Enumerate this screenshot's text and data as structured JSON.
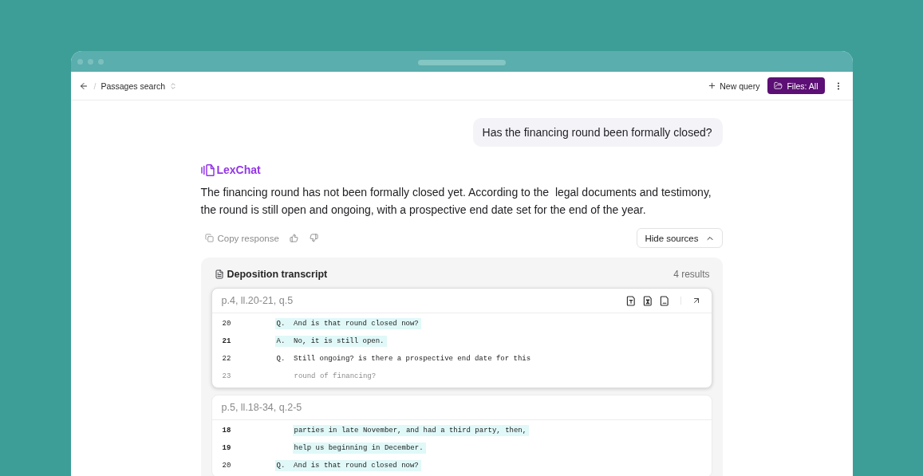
{
  "toolbar": {
    "separator": "/",
    "breadcrumb": "Passages search",
    "new_query": "New query",
    "files_button": "Files: All"
  },
  "conversation": {
    "question": "Has the financing round been formally closed?",
    "assistant_name": "LexChat",
    "answer": "The financing round has not been formally closed yet. According to the  legal documents and testimony, the round is still open and ongoing, with a prospective end date set for the end of the year.",
    "copy_action": "Copy response",
    "hide_sources": "Hide sources"
  },
  "sources": {
    "title": "Deposition transcript",
    "count": "4 results",
    "passages": [
      {
        "reference": "p.4, ll.20-21, q.5",
        "selected": true,
        "lines": [
          {
            "number": "20",
            "marker": "Q.",
            "text": "And is that round closed now?",
            "highlighted": true,
            "emphasized": false,
            "faded": false
          },
          {
            "number": "21",
            "marker": "A.",
            "text": "No, it is still open.",
            "highlighted": true,
            "emphasized": true,
            "faded": false
          },
          {
            "number": "22",
            "marker": "Q.",
            "text": "Still ongoing? is there a prospective end date for this",
            "highlighted": false,
            "emphasized": false,
            "faded": false
          },
          {
            "number": "23",
            "text": "round of financing?",
            "highlighted": false,
            "emphasized": false,
            "faded": true
          }
        ]
      },
      {
        "reference": "p.5, ll.18-34, q.2-5",
        "selected": false,
        "lines": [
          {
            "number": "18",
            "text": "parties in late November, and had a third party, then,",
            "highlighted": true,
            "emphasized": true,
            "faded": false
          },
          {
            "number": "19",
            "text": "help us beginning in December.",
            "highlighted": true,
            "emphasized": true,
            "faded": false
          },
          {
            "number": "20",
            "marker": "Q.",
            "text": "And is that round closed now?",
            "highlighted": true,
            "emphasized": false,
            "faded": false
          }
        ]
      }
    ]
  }
}
